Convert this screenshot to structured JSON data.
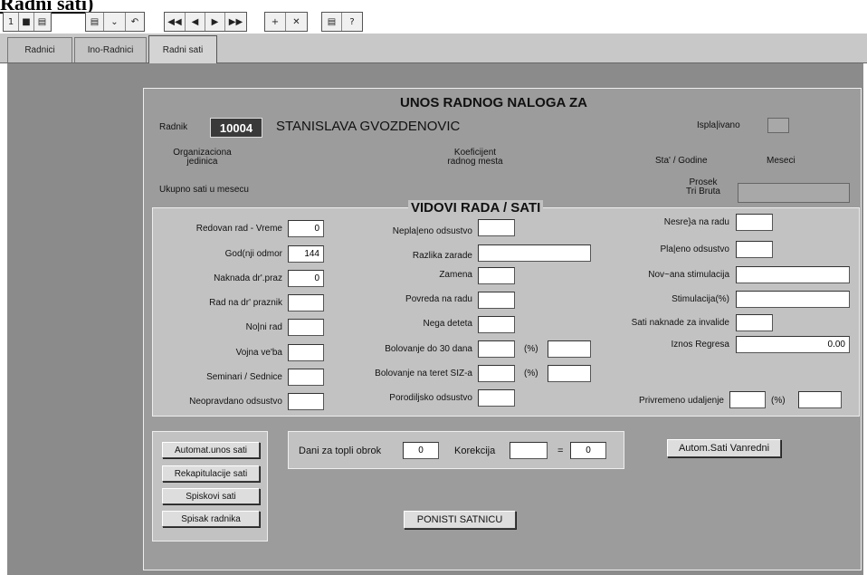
{
  "window_title": "Radni sati)",
  "toolbar": {
    "group1": [
      "1",
      "■",
      "▤"
    ],
    "group2": [
      "▤",
      "⌄",
      "↶"
    ],
    "group3": [
      "◀◀",
      "◀",
      "▶",
      "▶▶"
    ],
    "group4": [
      "+",
      "✕"
    ],
    "group5": [
      "▤",
      "?"
    ]
  },
  "tabs": [
    {
      "label": "Radnici"
    },
    {
      "label": "Ino-Radnici"
    },
    {
      "label": "Radni sati",
      "active": true
    }
  ],
  "header": {
    "title": "UNOS RADNOG NALOGA ZA",
    "radnik_label": "Radnik",
    "radnik_id": "10004",
    "radnik_name": "STANISLAVA GVOZDENOVIC",
    "isplacivano_label": "Ispla|ivano",
    "org_label": "Organizaciona jedinica",
    "koef_label": "Koeficijent radnog mesta",
    "staz_label": "Sta' / Godine",
    "meseci_label": "Meseci",
    "ukupno_label": "Ukupno sati u mesecu",
    "prosek_label": "Prosek Tri Bruta"
  },
  "section_title": "VIDOVI RADA / SATI",
  "col1": [
    {
      "label": "Redovan rad - Vreme",
      "value": "0"
    },
    {
      "label": "God(nji odmor",
      "value": "144"
    },
    {
      "label": "Naknada dr'.praz",
      "value": "0"
    },
    {
      "label": "Rad na dr' praznik",
      "value": ""
    },
    {
      "label": "No|ni rad",
      "value": ""
    },
    {
      "label": "Vojna ve'ba",
      "value": ""
    },
    {
      "label": "Seminari / Sednice",
      "value": ""
    },
    {
      "label": "Neopravdano odsustvo",
      "value": ""
    }
  ],
  "col2": [
    {
      "label": "Nepla|eno odsustvo",
      "value": ""
    },
    {
      "label": "Razlika zarade",
      "value": ""
    },
    {
      "label": "Zamena",
      "value": ""
    },
    {
      "label": "Povreda na radu",
      "value": ""
    },
    {
      "label": "Nega deteta",
      "value": ""
    },
    {
      "label": "Bolovanje do 30 dana",
      "value": "",
      "pct_label": "(%)",
      "pct_value": ""
    },
    {
      "label": "Bolovanje na teret SIZ-a",
      "value": "",
      "pct_label": "(%)",
      "pct_value": ""
    },
    {
      "label": "Porodiljsko odsustvo",
      "value": ""
    }
  ],
  "col3": [
    {
      "label": "Nesre}a na radu",
      "value": ""
    },
    {
      "label": "Pla|eno odsustvo",
      "value": ""
    },
    {
      "label": "Nov~ana stimulacija",
      "value": ""
    },
    {
      "label": "Stimulacija(%)",
      "value": ""
    },
    {
      "label": "Sati naknade za invalide",
      "value": ""
    },
    {
      "label": "Iznos Regresa",
      "value": "0.00"
    }
  ],
  "privremeno": {
    "label": "Privremeno udaljenje",
    "value": "",
    "pct_label": "(%)",
    "pct_value": ""
  },
  "buttons": {
    "automat": "Automat.unos sati",
    "rekap": "Rekapitulacije sati",
    "spiskovi": "Spiskovi sati",
    "spisak_radnika": "Spisak radnika",
    "autom_vanredni": "Autom.Sati Vanredni",
    "ponisti": "PONISTI SATNICU"
  },
  "obrok": {
    "label": "Dani za topli obrok",
    "value": "0",
    "korekcija_label": "Korekcija",
    "korekcija_value": "",
    "eq": "=",
    "result": "0"
  }
}
